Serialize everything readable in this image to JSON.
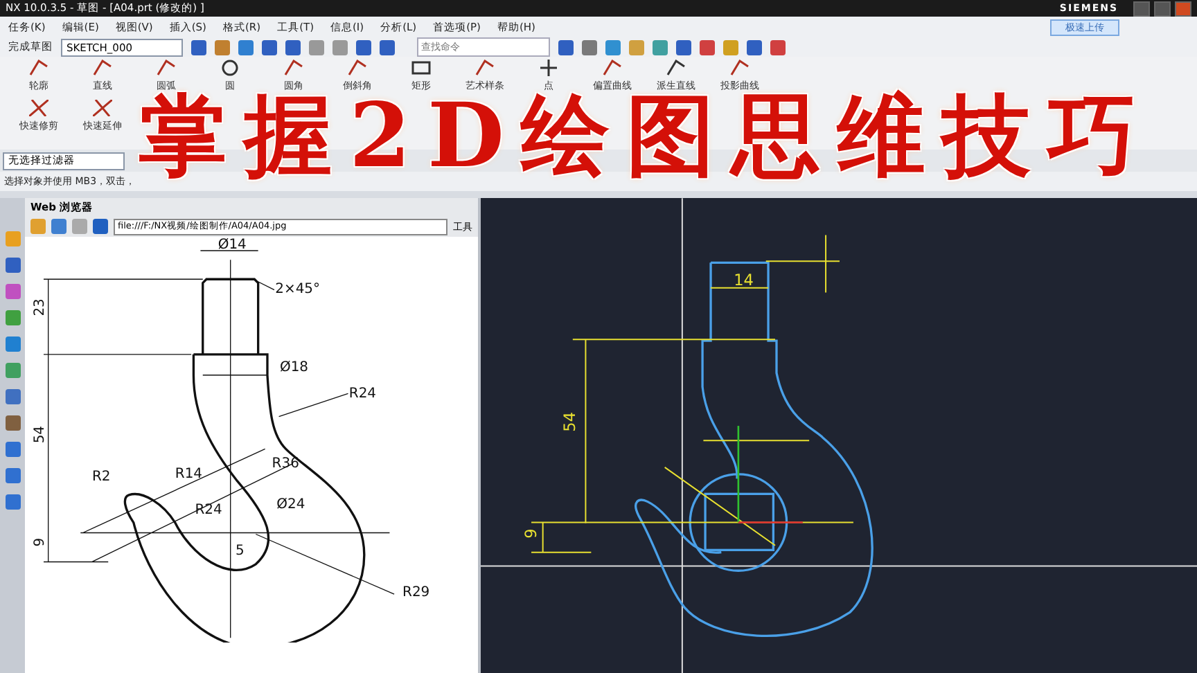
{
  "window": {
    "title": "NX 10.0.3.5 - 草图 - [A04.prt  (修改的) ]",
    "brand": "SIEMENS",
    "upload_button": "极速上传"
  },
  "menu": [
    "任务(K)",
    "编辑(E)",
    "视图(V)",
    "插入(S)",
    "格式(R)",
    "工具(T)",
    "信息(I)",
    "分析(L)",
    "首选项(P)",
    "帮助(H)"
  ],
  "toolbar": {
    "finish_sketch": "完成草图",
    "sketch_name": "SKETCH_000",
    "search": {
      "placeholder": "查找命令"
    }
  },
  "ribbon_row1": [
    "轮廓",
    "直线",
    "圆弧",
    "圆",
    "圆角",
    "倒斜角",
    "矩形",
    "艺术样条",
    "点",
    "偏置曲线",
    "派生直线",
    "投影曲线"
  ],
  "ribbon_row2": [
    "快速修剪",
    "快速延伸"
  ],
  "selection_bar": {
    "filter": "无选择过滤器"
  },
  "status_line": "选择对象并使用 MB3，双击，",
  "overlay_title": "掌握2D绘图思维技巧",
  "browser": {
    "title": "Web 浏览器",
    "url": "file:///F:/NX视频/绘图制作/A04/A04.jpg",
    "tools_menu": "工具",
    "drawing_labels": [
      "Ø14",
      "2×45°",
      "23",
      "Ø18",
      "R24",
      "54",
      "R36",
      "R2",
      "R14",
      "R24",
      "Ø24",
      "9",
      "5",
      "R29"
    ]
  },
  "canvas": {
    "dimension_labels": [
      "14",
      "54",
      "9"
    ]
  }
}
